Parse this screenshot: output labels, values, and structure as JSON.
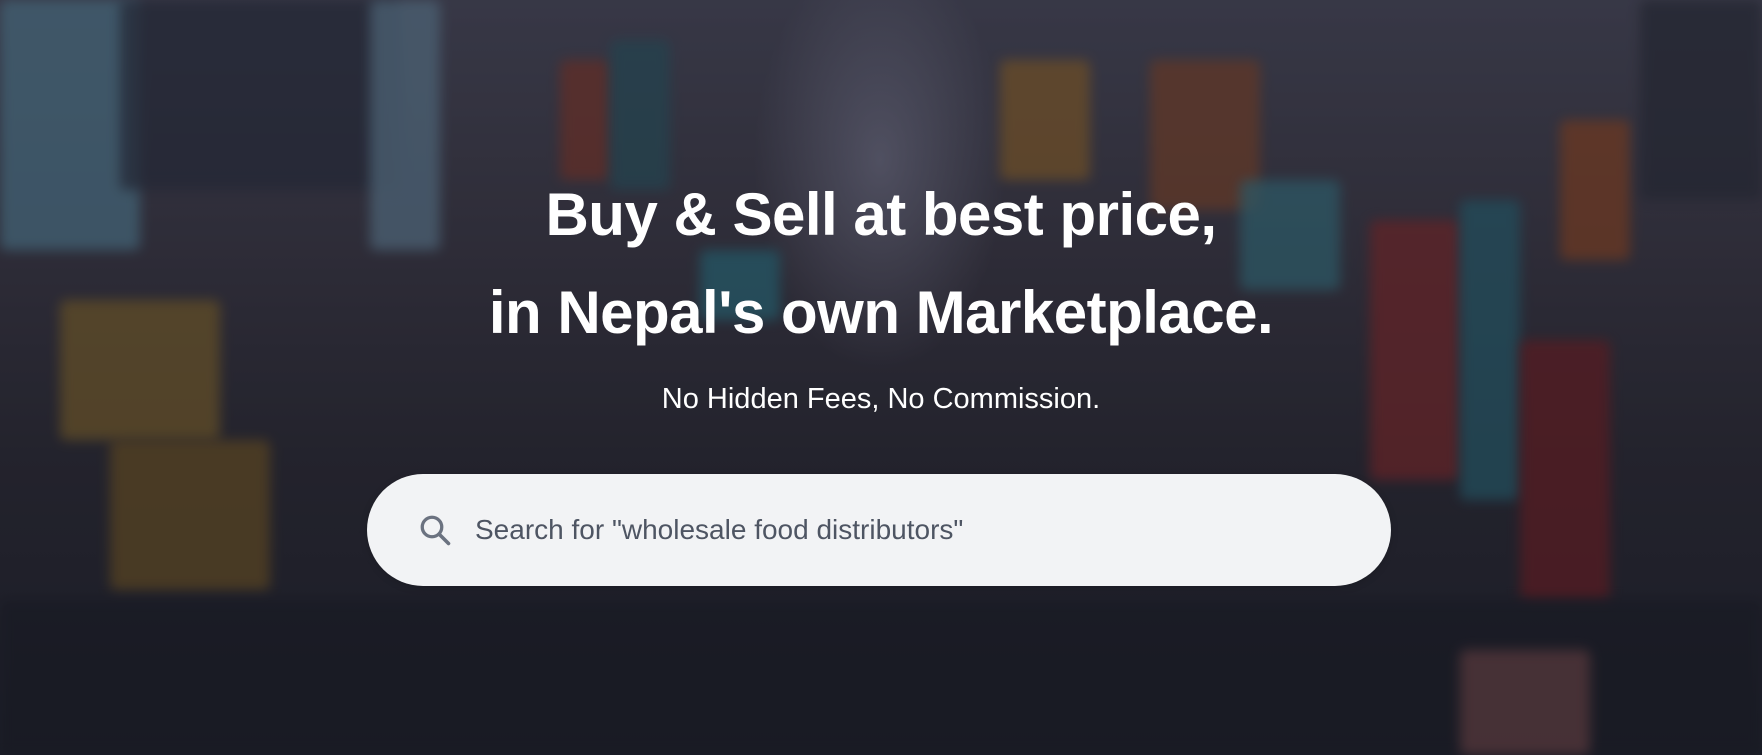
{
  "hero": {
    "headline_line1": "Buy & Sell at best price,",
    "headline_line2": "in Nepal's own Marketplace.",
    "subheadline": "No Hidden Fees, No Commission."
  },
  "search": {
    "placeholder": "Search for \"wholesale food distributors\"",
    "value": "",
    "icon": "search-icon"
  },
  "colors": {
    "headline_text": "#ffffff",
    "search_background": "#f2f3f5",
    "search_text": "#4e5563",
    "icon_color": "#6b7280"
  }
}
